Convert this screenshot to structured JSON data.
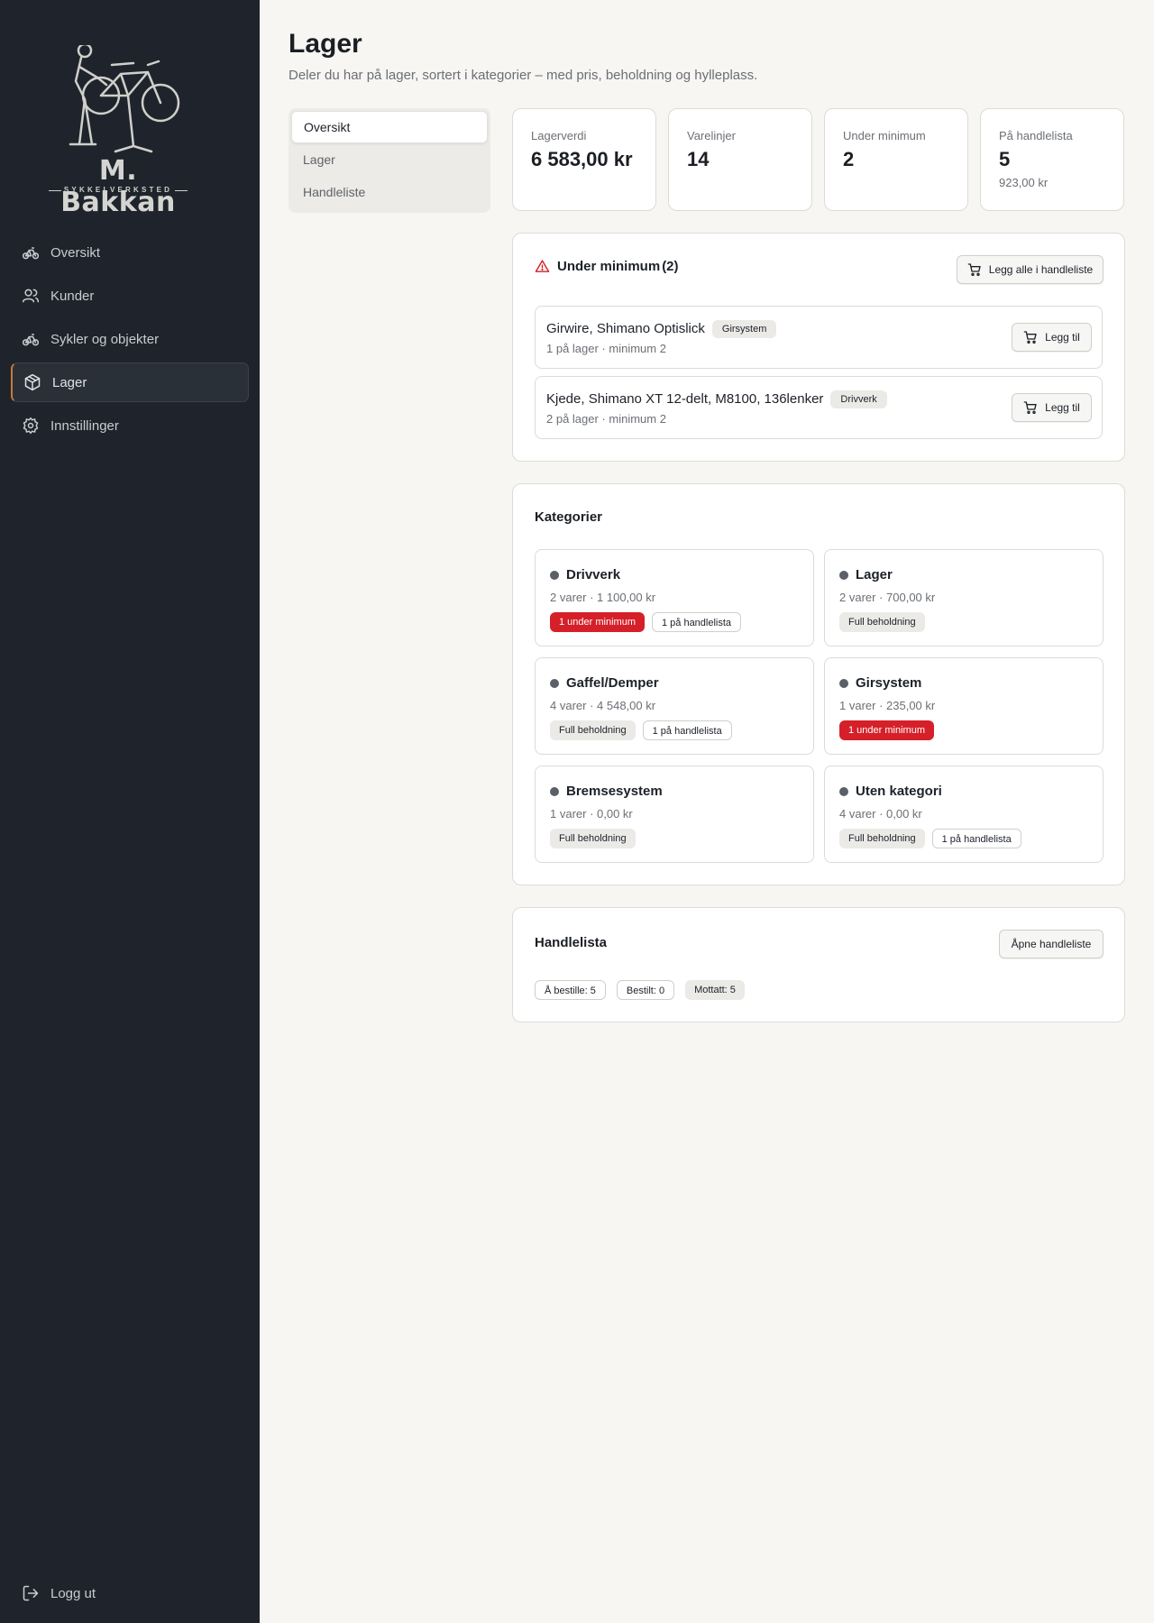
{
  "sidebar": {
    "logo_title": "M. Bakkan",
    "logo_sub": "SYKKELVERKSTED",
    "items": [
      {
        "label": "Oversikt",
        "icon": "bicycle-icon"
      },
      {
        "label": "Kunder",
        "icon": "users-icon"
      },
      {
        "label": "Sykler og objekter",
        "icon": "bicycle-icon"
      },
      {
        "label": "Lager",
        "icon": "package-icon",
        "active": true
      },
      {
        "label": "Innstillinger",
        "icon": "gear-icon"
      }
    ],
    "logout": "Logg ut"
  },
  "header": {
    "title": "Lager",
    "subtitle": "Deler du har på lager, sortert i kategorier – med pris, beholdning og hylleplass."
  },
  "subnav": [
    "Oversikt",
    "Lager",
    "Handleliste"
  ],
  "stats": [
    {
      "label": "Lagerverdi",
      "value": "6 583,00 kr"
    },
    {
      "label": "Varelinjer",
      "value": "14"
    },
    {
      "label": "Under minimum",
      "value": "2"
    },
    {
      "label": "På handlelista",
      "value": "5",
      "extra": "923,00 kr"
    }
  ],
  "under_minimum": {
    "title": "Under minimum",
    "count": "(2)",
    "add_all": "Legg alle i handleliste",
    "items": [
      {
        "name": "Girwire, Shimano Optislick",
        "tag": "Girsystem",
        "meta": "1 på lager · minimum 2",
        "button": "Legg til"
      },
      {
        "name": "Kjede, Shimano XT 12-delt, M8100, 136lenker",
        "tag": "Drivverk",
        "meta": "2 på lager · minimum 2",
        "button": "Legg til"
      }
    ]
  },
  "categories": {
    "title": "Kategorier",
    "items": [
      {
        "name": "Drivverk",
        "meta": "2 varer · 1 100,00 kr",
        "badges": [
          {
            "text": "1 under minimum",
            "style": "red"
          },
          {
            "text": "1 på handlelista",
            "style": "outline"
          }
        ]
      },
      {
        "name": "Lager",
        "meta": "2 varer · 700,00 kr",
        "badges": [
          {
            "text": "Full beholdning",
            "style": "gray"
          }
        ]
      },
      {
        "name": "Gaffel/Demper",
        "meta": "4 varer · 4 548,00 kr",
        "badges": [
          {
            "text": "Full beholdning",
            "style": "gray"
          },
          {
            "text": "1 på handlelista",
            "style": "outline"
          }
        ]
      },
      {
        "name": "Girsystem",
        "meta": "1 varer · 235,00 kr",
        "badges": [
          {
            "text": "1 under minimum",
            "style": "red"
          }
        ]
      },
      {
        "name": "Bremsesystem",
        "meta": "1 varer · 0,00 kr",
        "badges": [
          {
            "text": "Full beholdning",
            "style": "gray"
          }
        ]
      },
      {
        "name": "Uten kategori",
        "meta": "4 varer · 0,00 kr",
        "badges": [
          {
            "text": "Full beholdning",
            "style": "gray"
          },
          {
            "text": "1 på handlelista",
            "style": "outline"
          }
        ]
      }
    ]
  },
  "handlelista": {
    "title": "Handlelista",
    "open_button": "Åpne handleliste",
    "chips": [
      {
        "text": "Å bestille: 5",
        "style": "outline"
      },
      {
        "text": "Bestilt: 0",
        "style": "outline"
      },
      {
        "text": "Mottatt: 5",
        "style": "gray"
      }
    ]
  },
  "colors": {
    "sidebar_bg": "#1f242c",
    "accent": "#c8793b",
    "danger": "#d52029",
    "page_bg": "#f7f6f3"
  }
}
